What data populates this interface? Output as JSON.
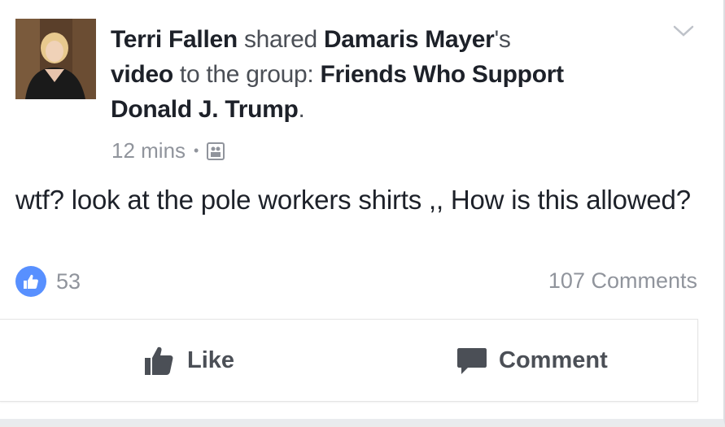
{
  "post": {
    "author": "Terri Fallen",
    "verb": "shared",
    "original_author": "Damaris Mayer",
    "possessive": "'s",
    "object": "video",
    "to_group_text": "to the group:",
    "group_name": "Friends Who Support  Donald J. Trump",
    "end_punct": ".",
    "timestamp": "12 mins",
    "separator": "•",
    "privacy_icon": "group-icon",
    "text": "wtf? look at the pole workers shirts ,, How is this allowed?"
  },
  "reactions": {
    "icon": "thumbs-up-icon",
    "count": "53",
    "comments": "107 Comments"
  },
  "actions": {
    "like_label": "Like",
    "comment_label": "Comment"
  },
  "colors": {
    "like_blue": "#5890ff",
    "text_dark": "#1d2129",
    "text_gray": "#90949c",
    "action_gray": "#4b4f56"
  }
}
